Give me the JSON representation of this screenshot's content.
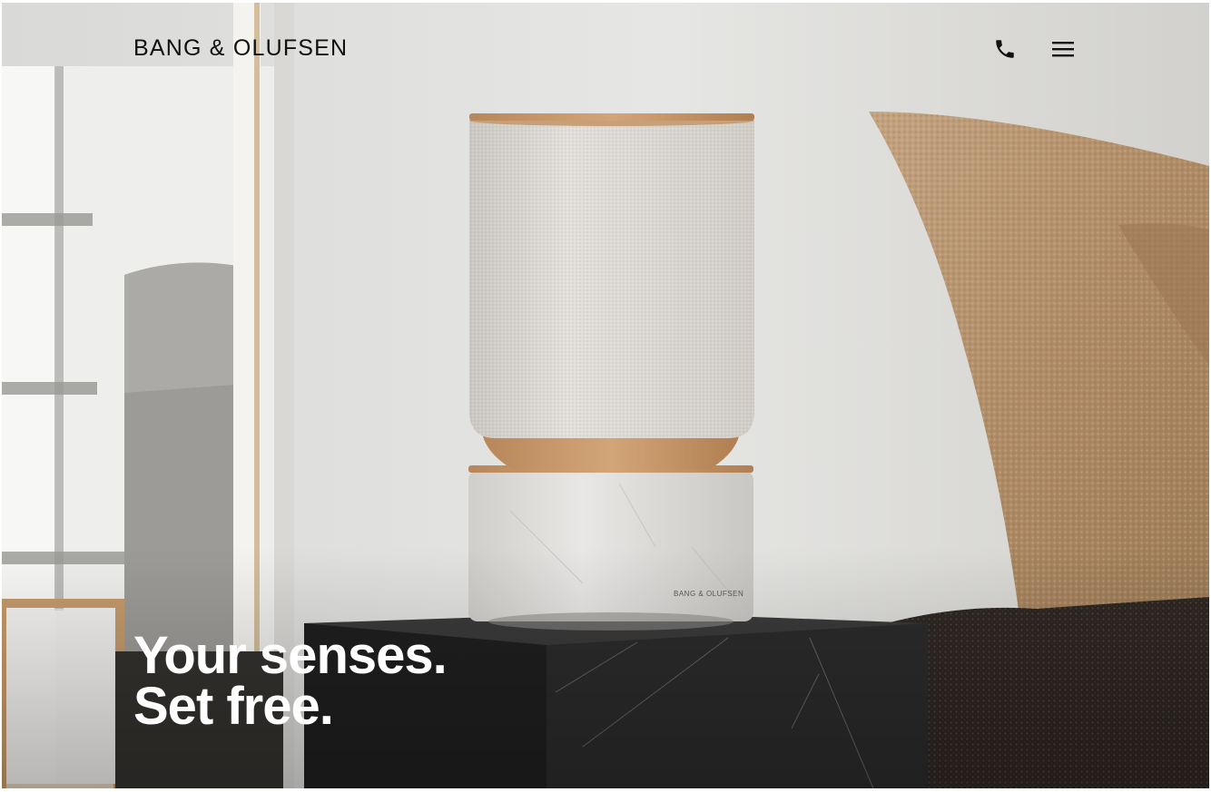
{
  "header": {
    "brand": "BANG & OLUFSEN",
    "phone_icon": "phone-icon",
    "menu_icon": "hamburger-menu-icon"
  },
  "hero": {
    "headline_line1": "Your senses.",
    "headline_line2": "Set free.",
    "product_badge": "BANG & OLUFSEN",
    "image_subject": "Beosound Balance speaker on black marble table"
  },
  "colors": {
    "wall": "#e3e3e1",
    "speaker_fabric": "#d8d5cf",
    "wood": "#c79a6b",
    "marble_light": "#dddcda",
    "marble_dark": "#2a2a2b",
    "cushion": "#b18e69",
    "headline_text": "#ffffff",
    "brand_text": "#111111"
  }
}
